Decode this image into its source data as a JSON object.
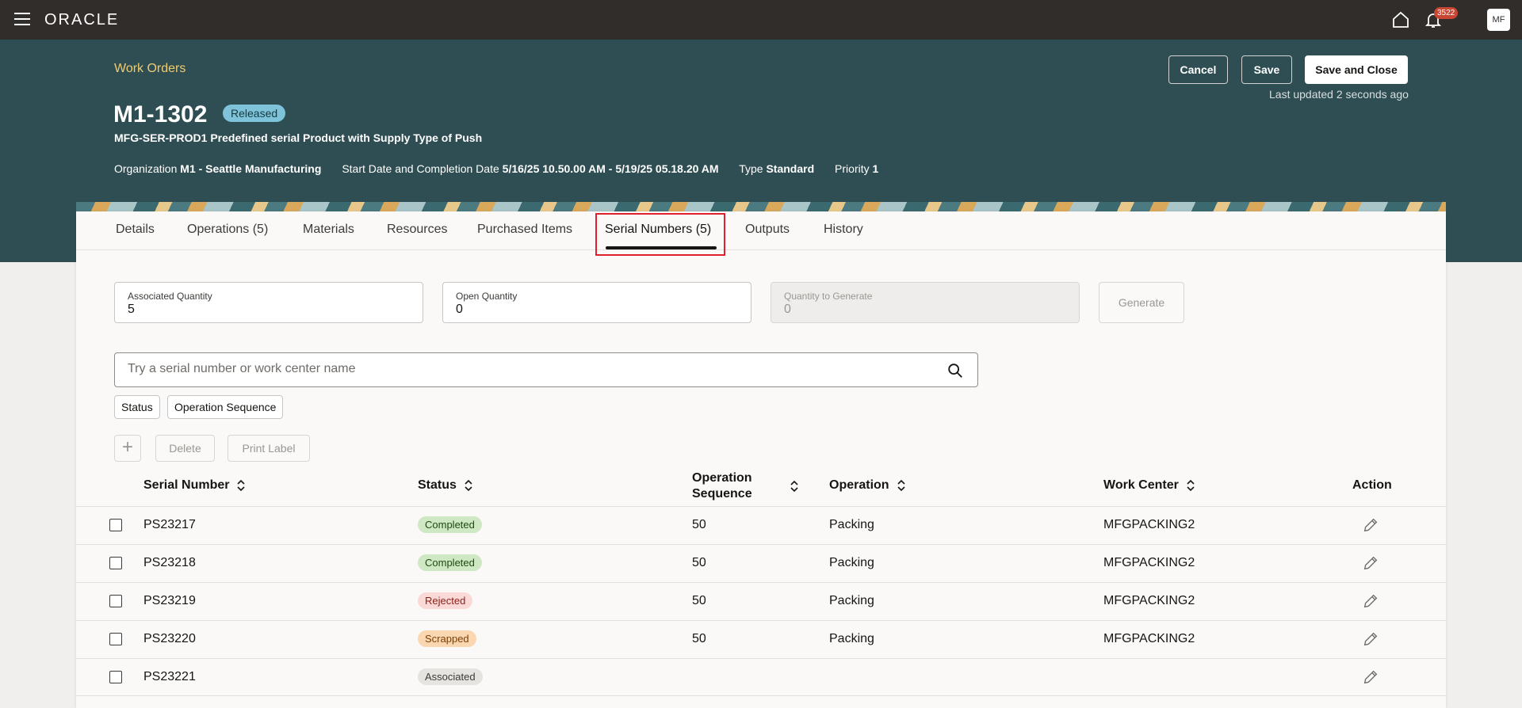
{
  "app": {
    "logo": "ORACLE",
    "notification_count": "3522",
    "user_initials": "MF"
  },
  "header": {
    "breadcrumb": "Work Orders",
    "title": "M1-1302",
    "status": "Released",
    "subtitle": "MFG-SER-PROD1 Predefined serial Product with Supply Type of Push",
    "meta": {
      "org_label": "Organization",
      "org_value": "M1 - Seattle Manufacturing",
      "dates_label": "Start Date and Completion Date",
      "dates_value": "5/16/25 10.50.00 AM - 5/19/25 05.18.20 AM",
      "type_label": "Type",
      "type_value": "Standard",
      "priority_label": "Priority",
      "priority_value": "1"
    },
    "buttons": {
      "cancel": "Cancel",
      "save": "Save",
      "save_close": "Save and Close"
    },
    "last_updated": "Last updated 2 seconds ago"
  },
  "tabs": [
    "Details",
    "Operations (5)",
    "Materials",
    "Resources",
    "Purchased Items",
    "Serial Numbers (5)",
    "Outputs",
    "History"
  ],
  "active_tab": "Serial Numbers (5)",
  "quantities": {
    "associated_label": "Associated Quantity",
    "associated_value": "5",
    "open_label": "Open Quantity",
    "open_value": "0",
    "generate_label": "Quantity to Generate",
    "generate_value": "0",
    "generate_button": "Generate"
  },
  "search": {
    "placeholder": "Try a serial number or work center name"
  },
  "filters": [
    "Status",
    "Operation Sequence"
  ],
  "toolbar": {
    "delete": "Delete",
    "print_label": "Print Label"
  },
  "table": {
    "headers": {
      "serial": "Serial Number",
      "status": "Status",
      "op_seq_1": "Operation",
      "op_seq_2": "Sequence",
      "operation": "Operation",
      "work_center": "Work Center",
      "action": "Action"
    },
    "rows": [
      {
        "serial": "PS23217",
        "status": "Completed",
        "seq": "50",
        "operation": "Packing",
        "work_center": "MFGPACKING2"
      },
      {
        "serial": "PS23218",
        "status": "Completed",
        "seq": "50",
        "operation": "Packing",
        "work_center": "MFGPACKING2"
      },
      {
        "serial": "PS23219",
        "status": "Rejected",
        "seq": "50",
        "operation": "Packing",
        "work_center": "MFGPACKING2"
      },
      {
        "serial": "PS23220",
        "status": "Scrapped",
        "seq": "50",
        "operation": "Packing",
        "work_center": "MFGPACKING2"
      },
      {
        "serial": "PS23221",
        "status": "Associated",
        "seq": "",
        "operation": "",
        "work_center": ""
      }
    ]
  },
  "colors": {
    "topbar": "#312d2a",
    "header_band": "#2f4e53",
    "breadcrumb": "#f0cc71",
    "completed": "#cde8c2",
    "rejected": "#fbd9d6",
    "scrapped": "#fad7b0",
    "associated": "#e6e4e1",
    "highlight": "#e0202f"
  }
}
